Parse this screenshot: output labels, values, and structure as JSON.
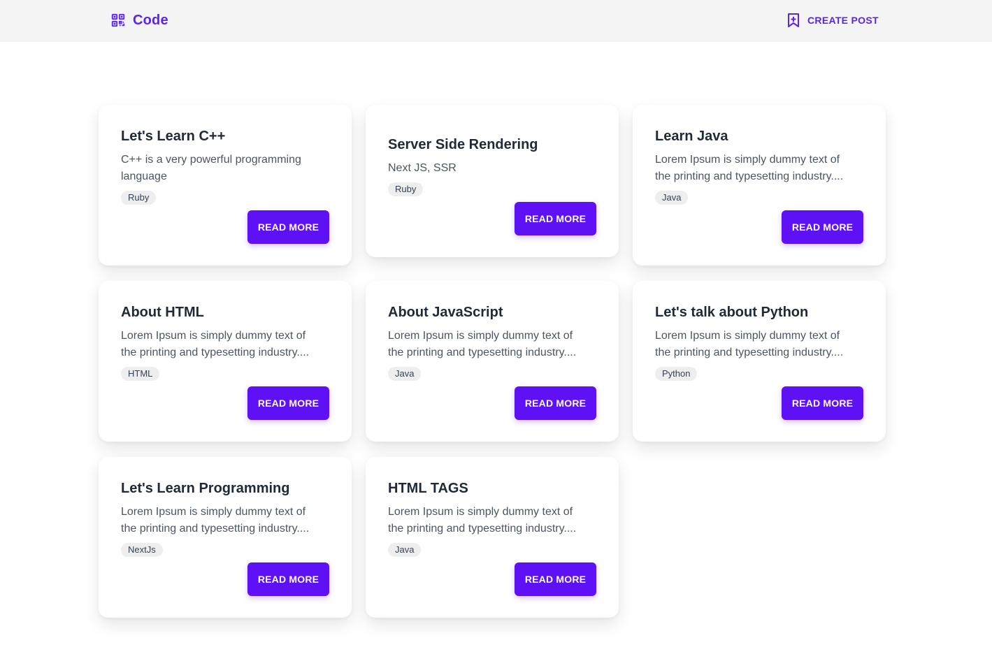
{
  "header": {
    "brand": "Code",
    "brand_icon": "qr-code-icon",
    "create_post_label": "CREATE POST",
    "create_post_icon": "bookmark-plus-icon"
  },
  "colors": {
    "accent": "#5f11f5",
    "brand_text": "#5b21f6",
    "navbar_bg": "#f4f4f4"
  },
  "posts": [
    {
      "title": "Let's Learn C++",
      "desc_line1": "C++ is a very powerful programming",
      "desc_line2": "language",
      "tag": "Ruby",
      "button": "READ MORE"
    },
    {
      "title": "Server Side Rendering",
      "desc_line1": "Next JS, SSR",
      "desc_line2": "",
      "tag": "Ruby",
      "button": "READ MORE"
    },
    {
      "title": "Learn Java",
      "desc_line1": "Lorem Ipsum is simply dummy text of",
      "desc_line2": "the printing and typesetting industry....",
      "tag": "Java",
      "button": "READ MORE"
    },
    {
      "title": "About HTML",
      "desc_line1": "Lorem Ipsum is simply dummy text of",
      "desc_line2": "the printing and typesetting industry....",
      "tag": "HTML",
      "button": "READ MORE"
    },
    {
      "title": "About JavaScript",
      "desc_line1": "Lorem Ipsum is simply dummy text of",
      "desc_line2": "the printing and typesetting industry....",
      "tag": "Java",
      "button": "READ MORE"
    },
    {
      "title": "Let's talk about Python",
      "desc_line1": "Lorem Ipsum is simply dummy text of",
      "desc_line2": "the printing and typesetting industry....",
      "tag": "Python",
      "button": "READ MORE"
    },
    {
      "title": "Let's Learn Programming",
      "desc_line1": "Lorem Ipsum is simply dummy text of",
      "desc_line2": "the printing and typesetting industry....",
      "tag": "NextJs",
      "button": "READ MORE"
    },
    {
      "title": "HTML TAGS",
      "desc_line1": "Lorem Ipsum is simply dummy text of",
      "desc_line2": "the printing and typesetting industry....",
      "tag": "Java",
      "button": "READ MORE"
    }
  ]
}
